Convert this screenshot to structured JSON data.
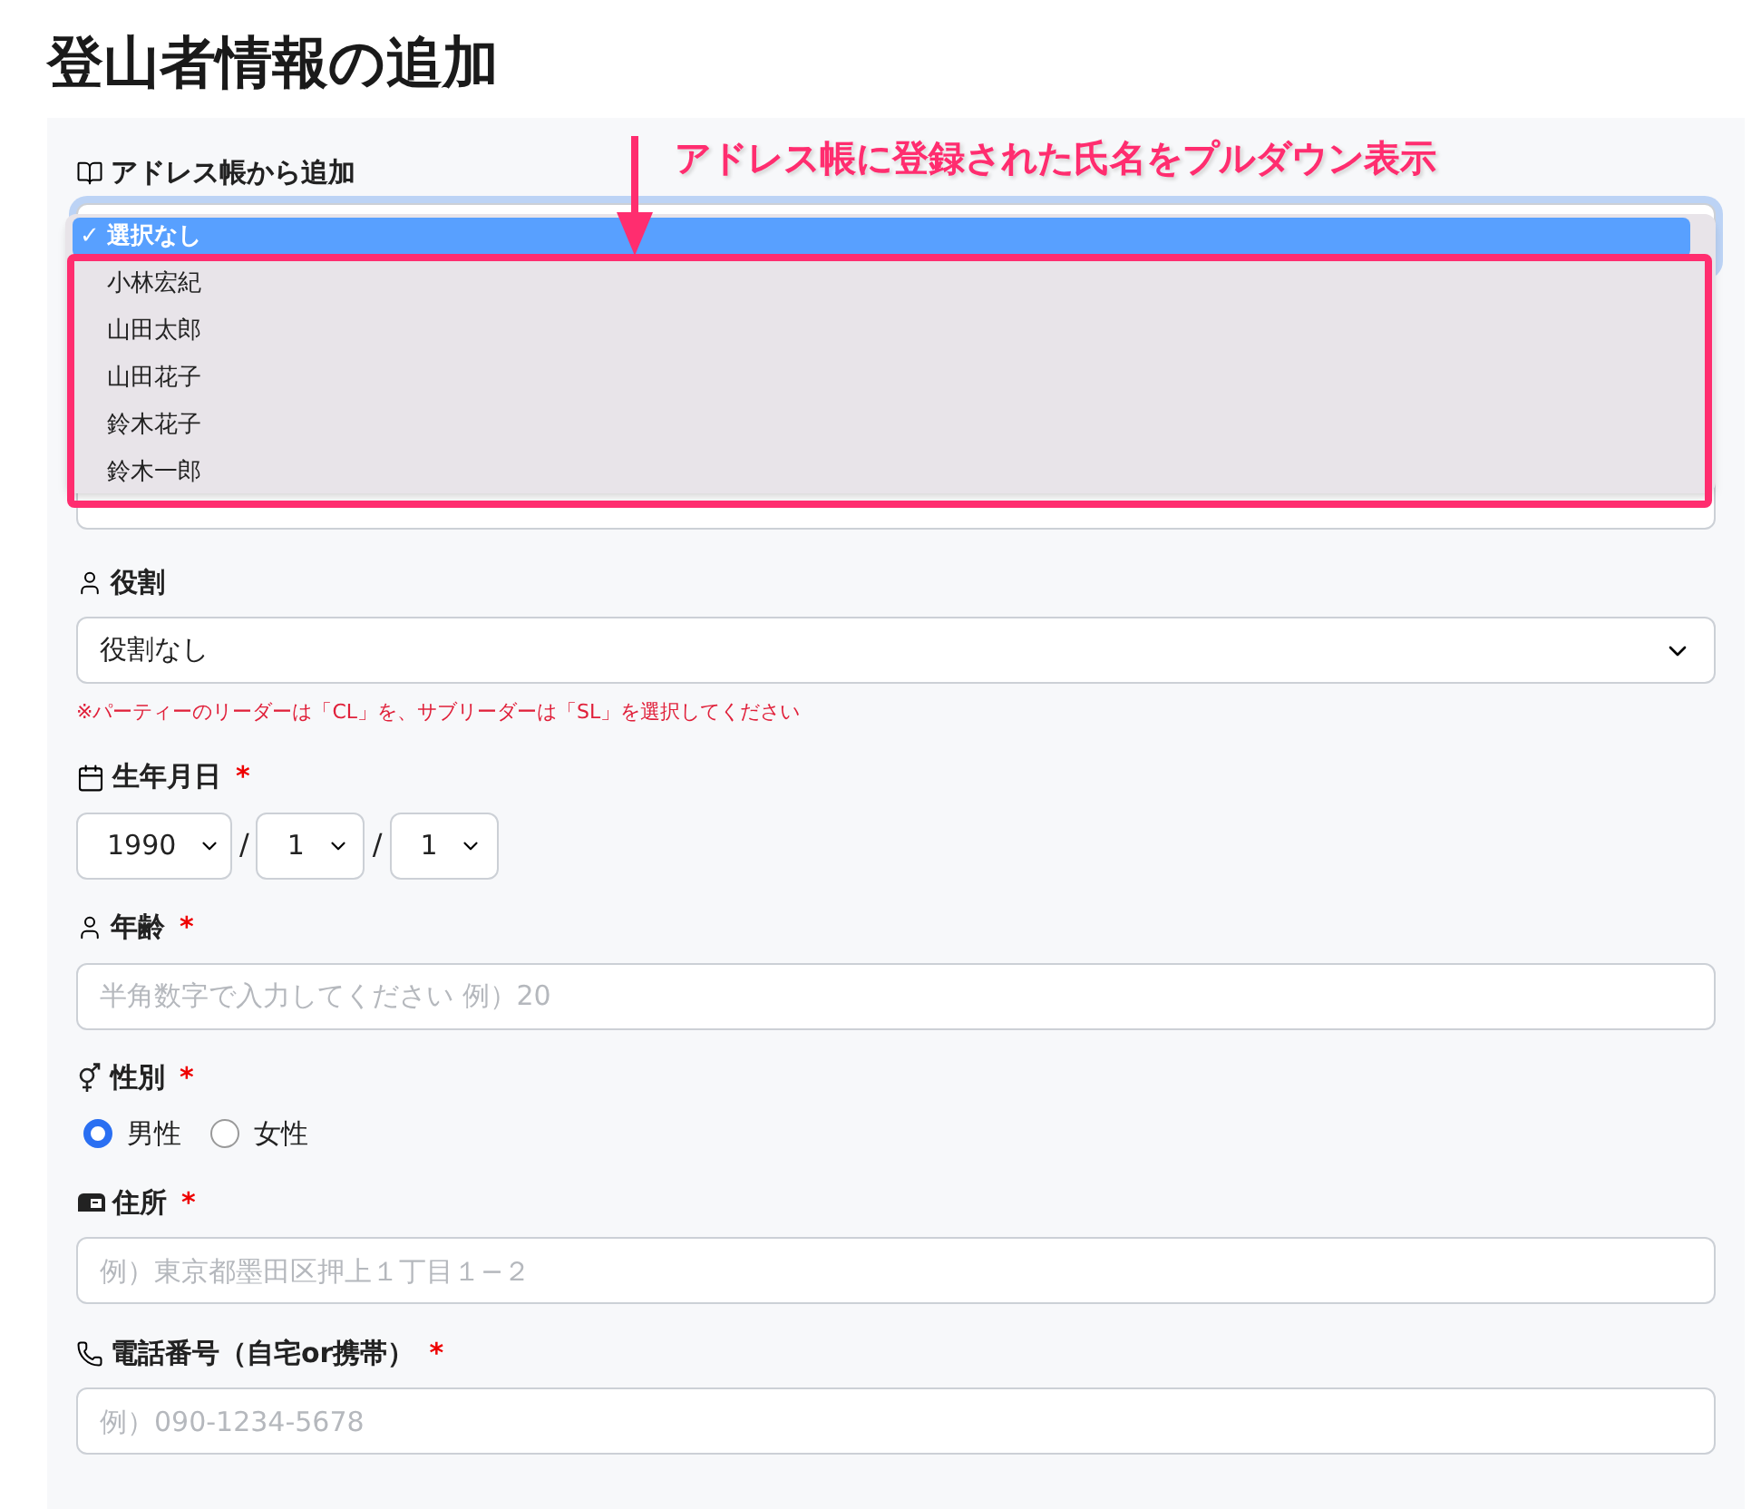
{
  "title": "登山者情報の追加",
  "annotation": {
    "text": "アドレス帳に登録された氏名をプルダウン表示"
  },
  "required_mark": "*",
  "address_book": {
    "label": "アドレス帳から追加",
    "check": "✓",
    "options": [
      {
        "label": "選択なし",
        "selected": true
      },
      {
        "label": "小林宏紀",
        "selected": false
      },
      {
        "label": "山田太郎",
        "selected": false
      },
      {
        "label": "山田花子",
        "selected": false
      },
      {
        "label": "鈴木花子",
        "selected": false
      },
      {
        "label": "鈴木一郎",
        "selected": false
      }
    ]
  },
  "fields": [
    {
      "kind": "select",
      "label": "役割",
      "value": "役割なし",
      "note": "※パーティーのリーダーは「CL」を、サブリーダーは「SL」を選択してください"
    },
    {
      "kind": "date",
      "label": "生年月日",
      "required": true,
      "parts": [
        {
          "value": "1990"
        },
        {
          "value": "1"
        },
        {
          "value": "1"
        }
      ],
      "separators": [
        "/",
        "/"
      ]
    },
    {
      "kind": "text",
      "label": "年齢",
      "required": true,
      "placeholder": "半角数字で入力してください 例）20"
    },
    {
      "kind": "radio",
      "label": "性別",
      "required": true,
      "options": [
        {
          "label": "男性",
          "selected": true
        },
        {
          "label": "女性",
          "selected": false
        }
      ]
    },
    {
      "kind": "text",
      "label": "住所",
      "required": true,
      "placeholder": "例）東京都墨田区押上１丁目１−２"
    },
    {
      "kind": "text",
      "label": "電話番号（自宅or携帯）",
      "required": true,
      "placeholder": "例）090-1234-5678"
    }
  ]
}
